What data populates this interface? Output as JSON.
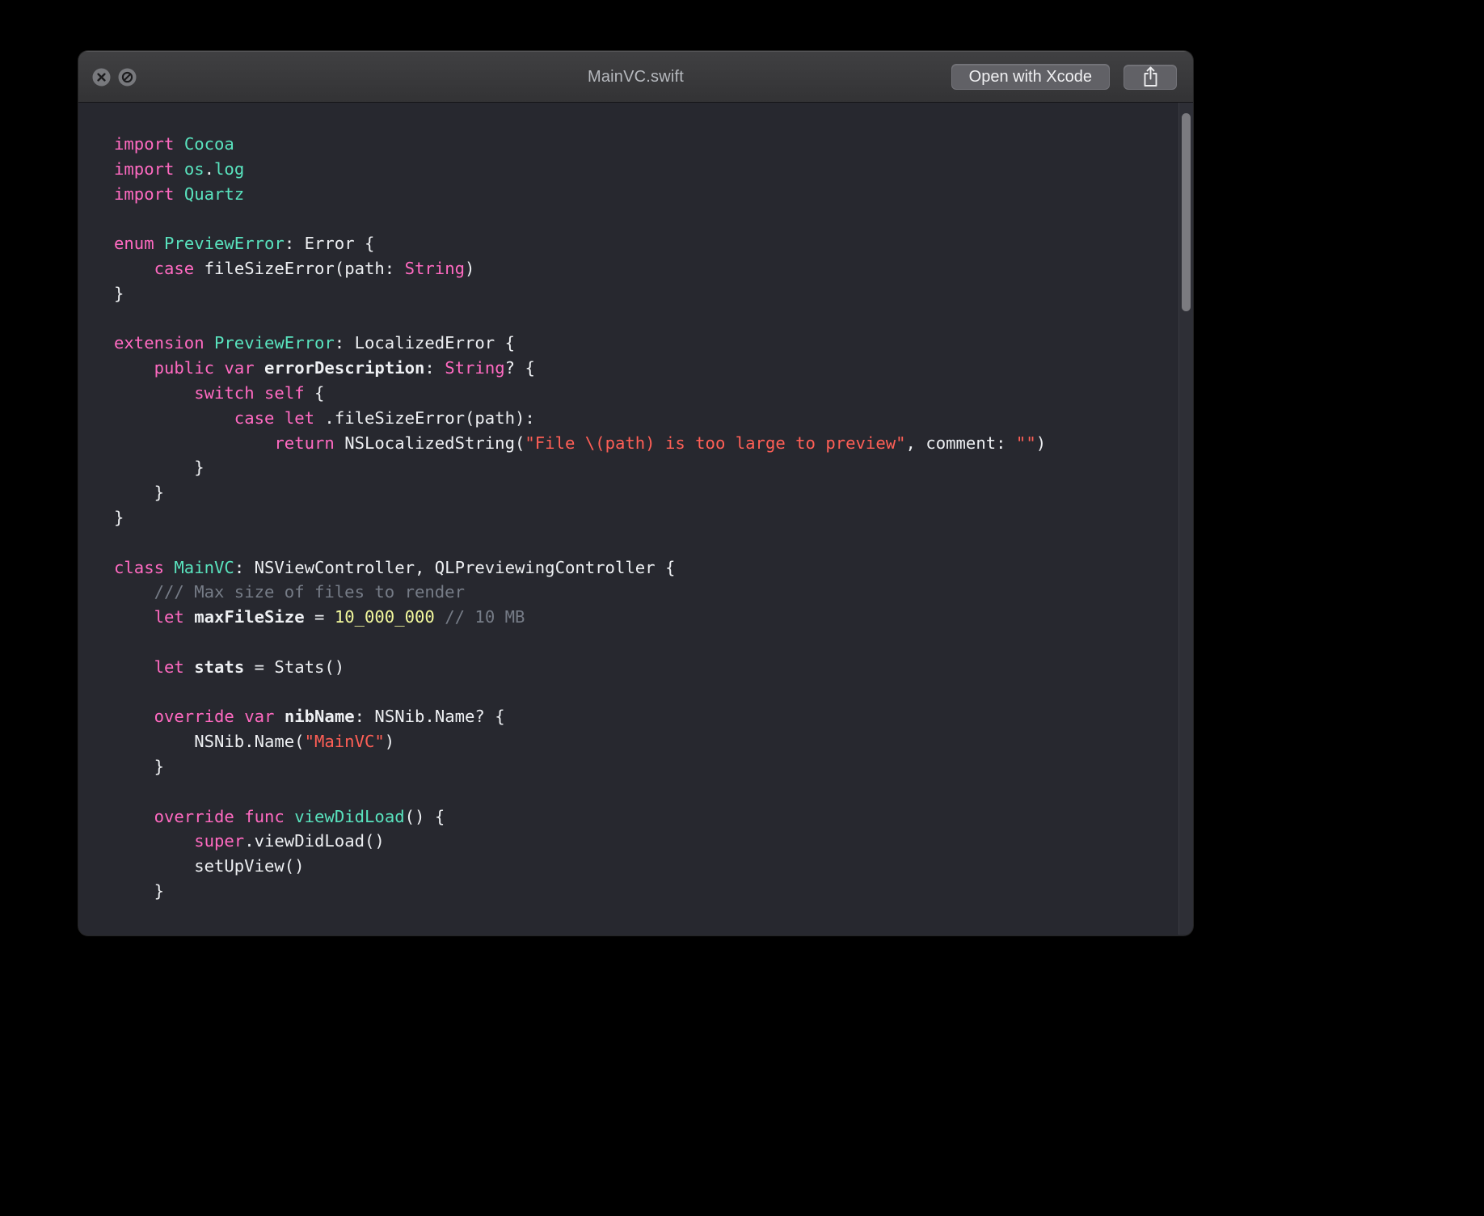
{
  "window": {
    "title": "MainVC.swift",
    "buttons": {
      "open_with_xcode": "Open with Xcode"
    },
    "icons": {
      "close": "close-icon",
      "stop": "prohibit-icon",
      "share": "share-icon"
    }
  },
  "colors": {
    "keyword": "#ff6ac1",
    "type": "#59e3be",
    "string": "#ff5f56",
    "number": "#f3f99d",
    "comment": "#767c87",
    "plain": "#edeff2",
    "code_background": "#27282f",
    "titlebar_background": "#39393b",
    "titlebar_text": "#b6b9be",
    "toolbar_button_background": "#616166",
    "toolbar_button_text": "#f1f1f3"
  },
  "code": {
    "lines": [
      [
        [
          "import",
          "k"
        ],
        [
          " ",
          "p"
        ],
        [
          "Cocoa",
          "t"
        ]
      ],
      [
        [
          "import",
          "k"
        ],
        [
          " ",
          "p"
        ],
        [
          "os",
          "t"
        ],
        [
          ".",
          "p"
        ],
        [
          "log",
          "t"
        ]
      ],
      [
        [
          "import",
          "k"
        ],
        [
          " ",
          "p"
        ],
        [
          "Quartz",
          "t"
        ]
      ],
      [],
      [
        [
          "enum",
          "k"
        ],
        [
          " ",
          "p"
        ],
        [
          "PreviewError",
          "t"
        ],
        [
          ": Error {",
          "p"
        ]
      ],
      [
        [
          "    ",
          "p"
        ],
        [
          "case",
          "k"
        ],
        [
          " fileSizeError(path: ",
          "p"
        ],
        [
          "String",
          "k"
        ],
        [
          ")",
          "p"
        ]
      ],
      [
        [
          "}",
          "p"
        ]
      ],
      [],
      [
        [
          "extension",
          "k"
        ],
        [
          " ",
          "p"
        ],
        [
          "PreviewError",
          "t"
        ],
        [
          ": LocalizedError {",
          "p"
        ]
      ],
      [
        [
          "    ",
          "p"
        ],
        [
          "public",
          "k"
        ],
        [
          " ",
          "p"
        ],
        [
          "var",
          "k"
        ],
        [
          " ",
          "p"
        ],
        [
          "errorDescription",
          "b"
        ],
        [
          ": ",
          "p"
        ],
        [
          "String",
          "k"
        ],
        [
          "? {",
          "p"
        ]
      ],
      [
        [
          "        ",
          "p"
        ],
        [
          "switch",
          "k"
        ],
        [
          " ",
          "p"
        ],
        [
          "self",
          "k"
        ],
        [
          " {",
          "p"
        ]
      ],
      [
        [
          "            ",
          "p"
        ],
        [
          "case",
          "k"
        ],
        [
          " ",
          "p"
        ],
        [
          "let",
          "k"
        ],
        [
          " .fileSizeError(path):",
          "p"
        ]
      ],
      [
        [
          "                ",
          "p"
        ],
        [
          "return",
          "k"
        ],
        [
          " NSLocalizedString(",
          "p"
        ],
        [
          "\"File \\(path) is too large to preview\"",
          "s"
        ],
        [
          ", comment: ",
          "p"
        ],
        [
          "\"\"",
          "s"
        ],
        [
          ")",
          "p"
        ]
      ],
      [
        [
          "        }",
          "p"
        ]
      ],
      [
        [
          "    }",
          "p"
        ]
      ],
      [
        [
          "}",
          "p"
        ]
      ],
      [],
      [
        [
          "class",
          "k"
        ],
        [
          " ",
          "p"
        ],
        [
          "MainVC",
          "t"
        ],
        [
          ": NSViewController, QLPreviewingController {",
          "p"
        ]
      ],
      [
        [
          "    ",
          "p"
        ],
        [
          "/// Max size of files to render",
          "c"
        ]
      ],
      [
        [
          "    ",
          "p"
        ],
        [
          "let",
          "k"
        ],
        [
          " ",
          "p"
        ],
        [
          "maxFileSize",
          "b"
        ],
        [
          " = ",
          "p"
        ],
        [
          "10_000_000",
          "n"
        ],
        [
          " ",
          "p"
        ],
        [
          "// 10 MB",
          "c"
        ]
      ],
      [],
      [
        [
          "    ",
          "p"
        ],
        [
          "let",
          "k"
        ],
        [
          " ",
          "p"
        ],
        [
          "stats",
          "b"
        ],
        [
          " = Stats()",
          "p"
        ]
      ],
      [],
      [
        [
          "    ",
          "p"
        ],
        [
          "override",
          "k"
        ],
        [
          " ",
          "p"
        ],
        [
          "var",
          "k"
        ],
        [
          " ",
          "p"
        ],
        [
          "nibName",
          "b"
        ],
        [
          ": NSNib.Name? {",
          "p"
        ]
      ],
      [
        [
          "        NSNib.Name(",
          "p"
        ],
        [
          "\"MainVC\"",
          "s"
        ],
        [
          ")",
          "p"
        ]
      ],
      [
        [
          "    }",
          "p"
        ]
      ],
      [],
      [
        [
          "    ",
          "p"
        ],
        [
          "override",
          "k"
        ],
        [
          " ",
          "p"
        ],
        [
          "func",
          "k"
        ],
        [
          " ",
          "p"
        ],
        [
          "viewDidLoad",
          "t"
        ],
        [
          "() {",
          "p"
        ]
      ],
      [
        [
          "        ",
          "p"
        ],
        [
          "super",
          "k"
        ],
        [
          ".viewDidLoad()",
          "p"
        ]
      ],
      [
        [
          "        setUpView()",
          "p"
        ]
      ],
      [
        [
          "    }",
          "p"
        ]
      ]
    ]
  },
  "scrollbar": {
    "visible": true
  }
}
